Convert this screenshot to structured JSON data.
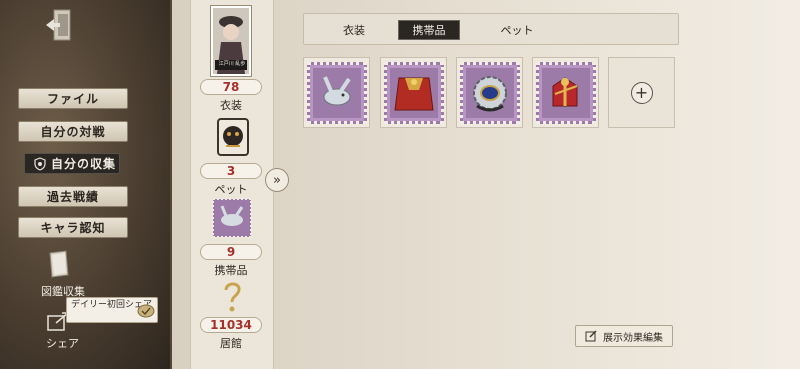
{
  "sidebar": {
    "nav": [
      {
        "label": "ファイル"
      },
      {
        "label": "自分の対戦"
      },
      {
        "label": "自分の収集"
      },
      {
        "label": "過去戦績"
      },
      {
        "label": "キャラ認知"
      }
    ],
    "gallery_label": "図鑑収集",
    "share_label": "シェア",
    "daily_share_bubble": "デイリー初回シェア"
  },
  "stats": {
    "portrait_caption": "江戸川 乱歩",
    "costumes": {
      "value": "78",
      "label": "衣装"
    },
    "pets": {
      "value": "3",
      "label": "ペット"
    },
    "accessories": {
      "value": "9",
      "label": "携帯品"
    },
    "residence": {
      "value": "11034",
      "label": "居館"
    }
  },
  "tabs": [
    {
      "label": "衣装"
    },
    {
      "label": "携帯品"
    },
    {
      "label": "ペット"
    }
  ],
  "active_tab": "携帯品",
  "items": [
    {
      "icon": "silver-rabbit-icon"
    },
    {
      "icon": "red-cape-icon"
    },
    {
      "icon": "blue-gem-gear-icon"
    },
    {
      "icon": "red-gift-bow-icon"
    },
    {
      "icon": "plus-icon",
      "empty": true
    }
  ],
  "edit_button_label": "展示効果編集",
  "colors": {
    "accent_red": "#a7312a",
    "active_tab_bg": "#2a2622",
    "stamp_purple": "#9c7ba8"
  }
}
